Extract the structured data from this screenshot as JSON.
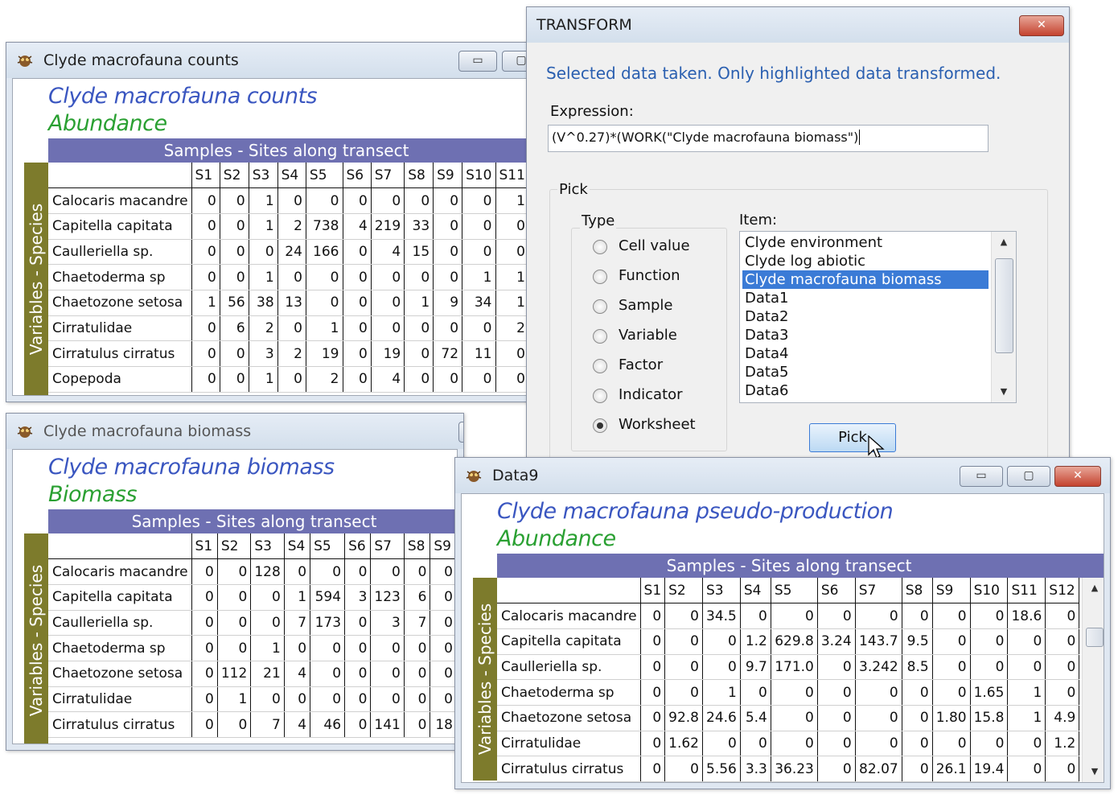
{
  "col_labels": [
    "S1",
    "S2",
    "S3",
    "S4",
    "S5",
    "S6",
    "S7",
    "S8",
    "S9",
    "S10",
    "S11",
    "S12"
  ],
  "counts": {
    "title": "Clyde macrofauna counts",
    "heading": "Clyde macrofauna counts",
    "subheading": "Abundance",
    "band": "Samples - Sites along transect",
    "vband": "Variables - Species",
    "columns": [
      "S1",
      "S2",
      "S3",
      "S4",
      "S5",
      "S6",
      "S7",
      "S8",
      "S9",
      "S10",
      "S11"
    ],
    "rows": [
      {
        "name": "Calocaris macandre",
        "values": [
          "0",
          "0",
          "1",
          "0",
          "0",
          "0",
          "0",
          "0",
          "0",
          "0",
          "1"
        ]
      },
      {
        "name": "Capitella capitata",
        "values": [
          "0",
          "0",
          "1",
          "2",
          "738",
          "4",
          "219",
          "33",
          "0",
          "0",
          "0"
        ]
      },
      {
        "name": "Caulleriella sp.",
        "values": [
          "0",
          "0",
          "0",
          "24",
          "166",
          "0",
          "4",
          "15",
          "0",
          "0",
          "0"
        ]
      },
      {
        "name": "Chaetoderma sp",
        "values": [
          "0",
          "0",
          "1",
          "0",
          "0",
          "0",
          "0",
          "0",
          "0",
          "1",
          "1"
        ]
      },
      {
        "name": "Chaetozone setosa",
        "values": [
          "1",
          "56",
          "38",
          "13",
          "0",
          "0",
          "0",
          "1",
          "9",
          "34",
          "1"
        ]
      },
      {
        "name": "Cirratulidae",
        "values": [
          "0",
          "6",
          "2",
          "0",
          "1",
          "0",
          "0",
          "0",
          "0",
          "0",
          "2"
        ]
      },
      {
        "name": "Cirratulus cirratus",
        "values": [
          "0",
          "0",
          "3",
          "2",
          "19",
          "0",
          "19",
          "0",
          "72",
          "11",
          "0"
        ]
      },
      {
        "name": "Copepoda",
        "values": [
          "0",
          "0",
          "1",
          "0",
          "2",
          "0",
          "4",
          "0",
          "0",
          "0",
          "0"
        ]
      }
    ]
  },
  "biomass": {
    "title": "Clyde macrofauna biomass",
    "heading": "Clyde macrofauna biomass",
    "subheading": "Biomass",
    "band": "Samples - Sites along transect",
    "vband": "Variables - Species",
    "columns": [
      "S1",
      "S2",
      "S3",
      "S4",
      "S5",
      "S6",
      "S7",
      "S8",
      "S9"
    ],
    "rows": [
      {
        "name": "Calocaris macandre",
        "values": [
          "0",
          "0",
          "128",
          "0",
          "0",
          "0",
          "0",
          "0",
          "0"
        ]
      },
      {
        "name": "Capitella capitata",
        "values": [
          "0",
          "0",
          "0",
          "1",
          "594",
          "3",
          "123",
          "6",
          "0"
        ]
      },
      {
        "name": "Caulleriella sp.",
        "values": [
          "0",
          "0",
          "0",
          "7",
          "173",
          "0",
          "3",
          "7",
          "0"
        ]
      },
      {
        "name": "Chaetoderma sp",
        "values": [
          "0",
          "0",
          "1",
          "0",
          "0",
          "0",
          "0",
          "0",
          "0"
        ]
      },
      {
        "name": "Chaetozone setosa",
        "values": [
          "0",
          "112",
          "21",
          "4",
          "0",
          "0",
          "0",
          "0",
          "0"
        ]
      },
      {
        "name": "Cirratulidae",
        "values": [
          "0",
          "1",
          "0",
          "0",
          "0",
          "0",
          "0",
          "0",
          "0"
        ]
      },
      {
        "name": "Cirratulus cirratus",
        "values": [
          "0",
          "0",
          "7",
          "4",
          "46",
          "0",
          "141",
          "0",
          "18"
        ]
      }
    ]
  },
  "data9": {
    "title": "Data9",
    "heading": "Clyde macrofauna pseudo-production",
    "subheading": "Abundance",
    "band": "Samples - Sites along transect",
    "vband": "Variables - Species",
    "columns": [
      "S1",
      "S2",
      "S3",
      "S4",
      "S5",
      "S6",
      "S7",
      "S8",
      "S9",
      "S10",
      "S11",
      "S12"
    ],
    "rows": [
      {
        "name": "Calocaris macandre",
        "values": [
          "0",
          "0",
          "34.5",
          "0",
          "0",
          "0",
          "0",
          "0",
          "0",
          "0",
          "18.6",
          "0"
        ]
      },
      {
        "name": "Capitella capitata",
        "values": [
          "0",
          "0",
          "0",
          "1.2",
          "629.8",
          "3.24",
          "143.7",
          "9.5",
          "0",
          "0",
          "0",
          "0"
        ]
      },
      {
        "name": "Caulleriella sp.",
        "values": [
          "0",
          "0",
          "0",
          "9.7",
          "171.0",
          "0",
          "3.242",
          "8.5",
          "0",
          "0",
          "0",
          "0"
        ]
      },
      {
        "name": "Chaetoderma sp",
        "values": [
          "0",
          "0",
          "1",
          "0",
          "0",
          "0",
          "0",
          "0",
          "0",
          "1.65",
          "1",
          "0"
        ]
      },
      {
        "name": "Chaetozone setosa",
        "values": [
          "0",
          "92.8",
          "24.6",
          "5.4",
          "0",
          "0",
          "0",
          "0",
          "1.80",
          "15.8",
          "1",
          "4.9"
        ]
      },
      {
        "name": "Cirratulidae",
        "values": [
          "0",
          "1.62",
          "0",
          "0",
          "0",
          "0",
          "0",
          "0",
          "0",
          "0",
          "0",
          "1.2"
        ]
      },
      {
        "name": "Cirratulus cirratus",
        "values": [
          "0",
          "0",
          "5.56",
          "3.3",
          "36.23",
          "0",
          "82.07",
          "0",
          "26.1",
          "19.4",
          "0",
          "0"
        ]
      }
    ]
  },
  "transform": {
    "title": "TRANSFORM",
    "message": "Selected data taken. Only highlighted data transformed.",
    "expression_label": "Expression:",
    "expression_value": "(V^0.27)*(WORK(\"Clyde macrofauna biomass\")",
    "pick_group": "Pick",
    "type_label": "Type",
    "types": [
      "Cell value",
      "Function",
      "Sample",
      "Variable",
      "Factor",
      "Indicator",
      "Worksheet"
    ],
    "selected_type": "Worksheet",
    "item_label": "Item:",
    "items": [
      "Clyde environment",
      "Clyde log abiotic",
      "Clyde macrofauna biomass",
      "Data1",
      "Data2",
      "Data3",
      "Data4",
      "Data5",
      "Data6"
    ],
    "selected_item": "Clyde macrofauna biomass",
    "pick_button": "Pick",
    "close_glyph": "✕"
  },
  "window_buttons": {
    "minimize": "▭",
    "maximize": "▢",
    "close": "✕"
  },
  "colors": {
    "heading": "#3a56c0",
    "subheading": "#2aa032",
    "band": "#6e70b2",
    "vband": "#7d7b2c",
    "selection": "#3b7bd6",
    "message": "#2a5fb0"
  }
}
